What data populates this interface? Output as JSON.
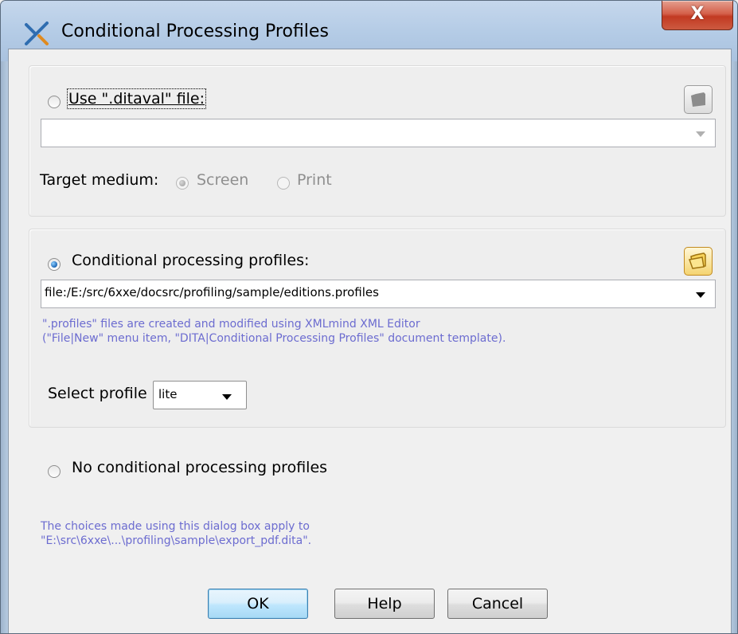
{
  "window": {
    "title": "Conditional Processing Profiles",
    "close_label": "X"
  },
  "ditaval": {
    "radio_label": "Use \".ditaval\" file:",
    "selected": false,
    "path_value": "",
    "target_medium_label": "Target medium:",
    "screen_label": "Screen",
    "print_label": "Print"
  },
  "profiles": {
    "radio_label": "Conditional processing profiles:",
    "selected": true,
    "path_value": "file:/E:/src/6xxe/docsrc/profiling/sample/editions.profiles",
    "note_line1": "\".profiles\" files are created and modified using XMLmind XML Editor",
    "note_line2": "(\"File|New\" menu item, \"DITA|Conditional Processing Profiles\" document template).",
    "select_profile_label": "Select profile",
    "selected_profile": "lite"
  },
  "none": {
    "radio_label": "No conditional processing profiles",
    "selected": false
  },
  "footer_note": {
    "line1": "The choices made using this dialog box apply to",
    "line2": "\"E:\\src\\6xxe\\...\\profiling\\sample\\export_pdf.dita\"."
  },
  "buttons": {
    "ok": "OK",
    "help": "Help",
    "cancel": "Cancel"
  },
  "colors": {
    "note_text": "#6c6cd0",
    "default_button": "#bee6fd",
    "titlebar": "#b9cde2"
  }
}
